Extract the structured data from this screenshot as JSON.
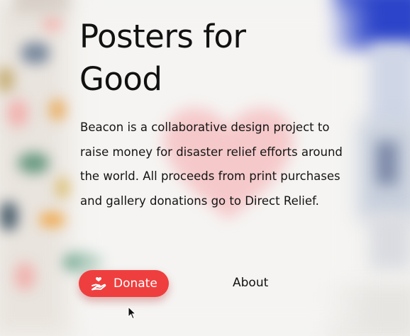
{
  "hero": {
    "title_line1": "Posters for",
    "title_line2": "Good",
    "description": "Beacon is a collaborative design project to raise money for disaster relief efforts around the world. All proceeds from print purchases and gallery donations go to Direct Relief."
  },
  "actions": {
    "donate_label": "Donate",
    "donate_icon": "hand-heart-icon",
    "about_label": "About"
  },
  "colors": {
    "accent": "#ef3e3e",
    "text": "#111111",
    "background": "#f4f3f1"
  }
}
